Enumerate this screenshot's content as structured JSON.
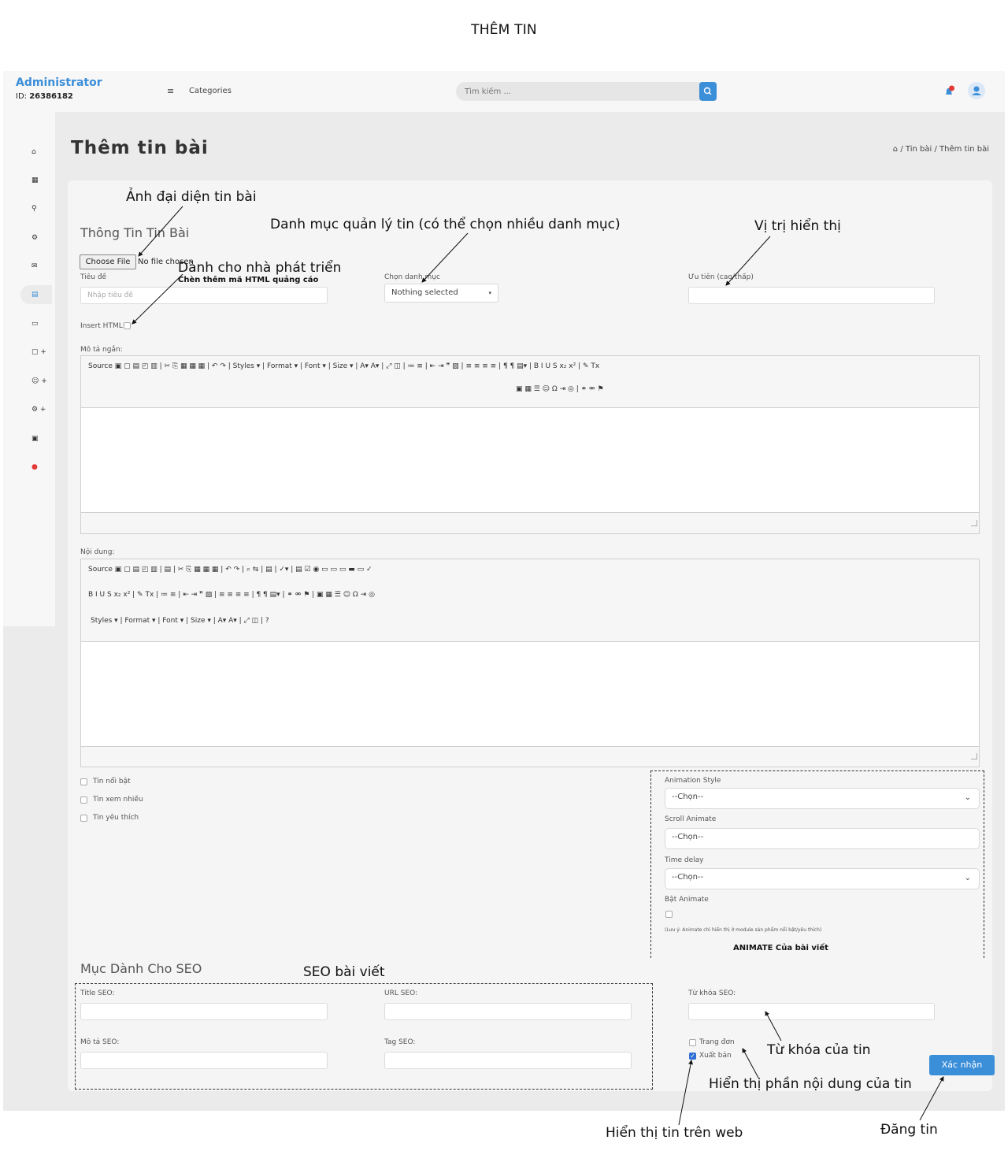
{
  "document_title": "THÊM TIN",
  "header": {
    "brand": "Administrator",
    "id_label": "ID:",
    "id_value": "26386182",
    "menu_icon": "≡",
    "categories_label": "Categories",
    "search_placeholder": "Tìm kiếm ..."
  },
  "sidebar": {
    "items": [
      {
        "icon": "home-icon",
        "glyph": "⌂"
      },
      {
        "icon": "dashboard-icon",
        "glyph": "▦"
      },
      {
        "icon": "link-icon",
        "glyph": "⚲"
      },
      {
        "icon": "gear-icon",
        "glyph": "⚙"
      },
      {
        "icon": "mail-icon",
        "glyph": "✉"
      },
      {
        "icon": "news-icon",
        "glyph": "▤"
      },
      {
        "icon": "monitor-icon",
        "glyph": "▭"
      },
      {
        "icon": "page-add-icon",
        "glyph": "▢ +"
      },
      {
        "icon": "user-add-icon",
        "glyph": "☺ +"
      },
      {
        "icon": "settings-add-icon",
        "glyph": "⚙ +"
      },
      {
        "icon": "gallery-icon",
        "glyph": "▣"
      },
      {
        "icon": "logout-icon",
        "glyph": "●"
      }
    ]
  },
  "page": {
    "heading": "Thêm tin bài",
    "breadcrumb_home": "⌂",
    "breadcrumb_1": "Tin bài",
    "breadcrumb_2": "Thêm tin bài",
    "breadcrumb_sep": "/"
  },
  "form": {
    "section_info": "Thông Tin Tin Bài",
    "choose_file": "Choose File",
    "no_file": "No file chosen",
    "title_label": "Tiêu đề",
    "title_placeholder": "Nhập tiêu đề",
    "category_label": "Chọn danh mục",
    "category_value": "Nothing selected",
    "priority_label": "Ưu tiên (cao/thấp)",
    "insert_html_label": "Insert HTML:",
    "short_desc_label": "Mô tả ngắn:",
    "content_label": "Nội dung:",
    "toolbar1_row1": "Source  ▣  ▢  ▤  ◰  ▥  |  ✂  ⎘  ▦  ▦  ▦  |  ↶  ↷  |  Styles ▾  |  Format ▾  |  Font ▾  |  Size ▾  |  A▾  A▾  |  ⤢  ◫  |  ≔  ≡  |  ⇤  ⇥  ❞  ▧  |  ≡  ≡  ≡  ≡  |  ¶  ¶  ▤▾  |  B  I  U  S  x₂  x²  |  ✎  Tx",
    "toolbar1_row2": "▣  ▦  ☰  ☺  Ω  ⇥  ◎  |  ⚭  ⚮  ⚑",
    "toolbar2_row1": "Source  ▣  ▢  ▤  ◰  ▥  |  ▤  |  ✂  ⎘  ▦  ▦  ▦  |  ↶  ↷  |  ⌕  ⇆  |  ▤  |  ✓▾  |  ▤  ☑  ◉  ▭  ▭  ▭  ▬  ▭  ✓",
    "toolbar2_row2": "B  I  U  S  x₂  x²  |  ✎  Tx  |  ≔  ≡  |  ⇤  ⇥  ❞  ▧  |  ≡  ≡  ≡  ≡  |  ¶  ¶  ▤▾  |  ⚭  ⚮  ⚑  |  ▣  ▦  ☰  ☺  Ω  ⇥  ◎",
    "toolbar2_row3": "Styles ▾  |  Format ▾  |  Font ▾  |  Size ▾  |  A▾  A▾  |  ⤢  ◫  |  ?",
    "checkboxes": [
      {
        "label": "Tin nổi bật",
        "checked": false
      },
      {
        "label": "Tin xem nhiều",
        "checked": false
      },
      {
        "label": "Tin yêu thích",
        "checked": false
      }
    ],
    "animation_style_label": "Animation Style",
    "animation_style_value": "--Chọn--",
    "scroll_animate_label": "Scroll Animate",
    "scroll_animate_value": "--Chọn--",
    "time_delay_label": "Time delay",
    "time_delay_value": "--Chọn--",
    "bat_animate_label": "Bật Animate",
    "animate_note": "(Lưu ý: Animate chỉ hiển thị ở module sản phẩm nổi bật/yêu thích)",
    "section_seo": "Mục Dành Cho SEO",
    "title_seo_label": "Title SEO:",
    "url_seo_label": "URL SEO:",
    "keyword_seo_label": "Từ khóa SEO:",
    "desc_seo_label": "Mô tả SEO:",
    "tag_seo_label": "Tag SEO:",
    "single_page_label": "Trang đơn",
    "publish_label": "Xuất bản",
    "submit_label": "Xác nhận"
  },
  "annotations": {
    "avatar": "Ảnh đại diện tin bài",
    "category": "Danh mục quản lý tin (có thể chọn nhiều danh mục)",
    "position": "Vị trị hiển thị",
    "developer": "Dành cho nhà phát triển",
    "developer_sub": "Chèn thêm mã HTML quảng cáo",
    "animate": "ANIMATE Của bài viết",
    "seo": "SEO bài viết",
    "keyword": "Từ khóa của tin",
    "content_display": "Hiển thị phần nội dung của tin",
    "web_display": "Hiển thị tin trên web",
    "publish": "Đăng tin"
  }
}
